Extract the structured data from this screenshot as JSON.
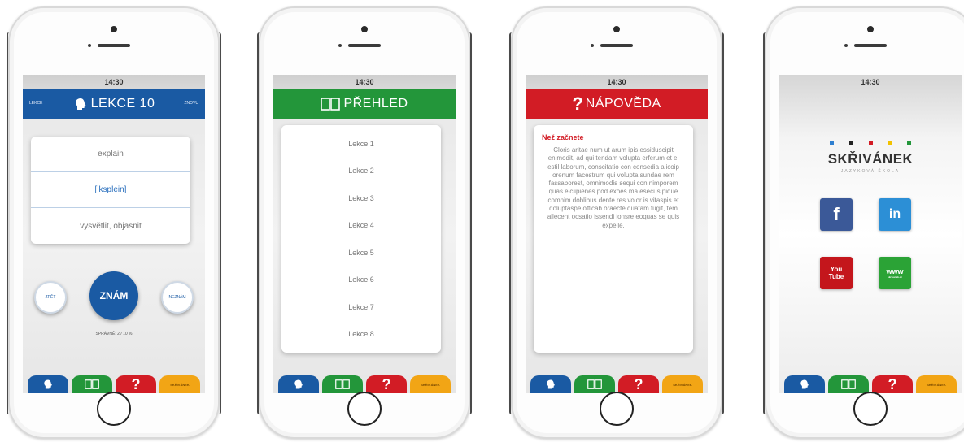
{
  "status_time": "14:30",
  "tabs": {
    "help_glyph": "?",
    "brand_label": "SKŘIVÁNEK"
  },
  "screen1": {
    "header_left": "LEKCE",
    "header_title": "LEKCE 10",
    "header_right": "ZNOVU",
    "word": "explain",
    "phonetic": "[iksplein]",
    "translation": "vysvětlit, objasnit",
    "back_label": "ZPĚT",
    "know_label": "ZNÁM",
    "dont_know_label": "NEZNÁM",
    "progress": "SPRÁVNĚ: 2 / 10 %"
  },
  "screen2": {
    "header_title": "PŘEHLED",
    "lessons": [
      "Lekce 1",
      "Lekce 2",
      "Lekce 3",
      "Lekce 4",
      "Lekce 5",
      "Lekce 6",
      "Lekce 7",
      "Lekce 8"
    ]
  },
  "screen3": {
    "header_title": "NÁPOVĚDA",
    "heading": "Než začnete",
    "body": "Cloris aritae num ut arum ipis essiduscipit enimodit, ad qui tendam volupta erferum et el estil laborum, conscitatio con consedia alicoip orenum facestrum qui volupta sundae rem fassaborest, omnimodis sequi con nimporem quas eiciipienes pod exoes ma esecus pique comnim doblibus dente res volor is vitaspis et doluptaspe officab oraecte quatam fugit, tem allecent ocsatio issendi ionsre eoquas se quis expelle."
  },
  "screen4": {
    "brand": "SKŘIVÁNEK",
    "brand_sub": "JAZYKOVÁ ŠKOLA",
    "facebook": "f",
    "linkedin": "in",
    "youtube_top": "You",
    "youtube_bottom": "Tube",
    "www": "www",
    "www_sub": "skrivanek.cz",
    "logo_dot_colors": [
      "#2f7fd0",
      "#222222",
      "#d21c25",
      "#f2c200",
      "#23963a"
    ]
  },
  "colors": {
    "blue": "#1a5aa3",
    "green": "#23963a",
    "red": "#d21c25",
    "yellow": "#f2a515"
  },
  "icons": [
    "head-brain-icon",
    "book-icon",
    "question-mark-icon",
    "facebook-icon",
    "linkedin-icon",
    "youtube-icon",
    "www-icon"
  ]
}
